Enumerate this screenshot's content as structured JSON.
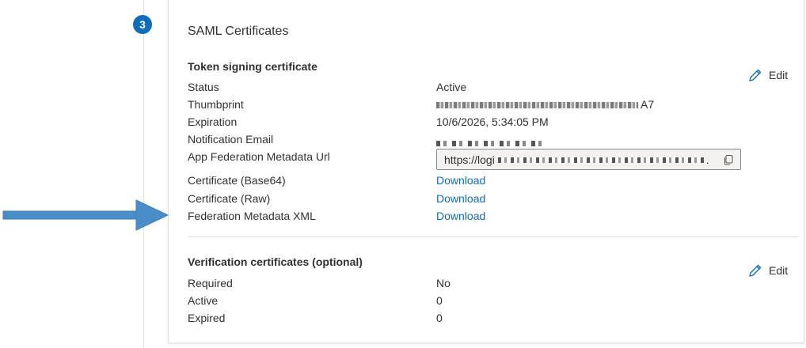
{
  "step": {
    "number": "3"
  },
  "card": {
    "title": "SAML Certificates"
  },
  "token_signing": {
    "title": "Token signing certificate",
    "edit_label": "Edit",
    "rows": [
      {
        "label": "Status",
        "value": "Active"
      },
      {
        "label": "Thumbprint",
        "value_suffix": "A7"
      },
      {
        "label": "Expiration",
        "value": "10/6/2026, 5:34:05 PM"
      },
      {
        "label": "Notification Email"
      },
      {
        "label": "App Federation Metadata Url",
        "url_prefix": "https://logi",
        "url_suffix": "."
      }
    ],
    "downloads": [
      {
        "label": "Certificate (Base64)",
        "link": "Download"
      },
      {
        "label": "Certificate (Raw)",
        "link": "Download"
      },
      {
        "label": "Federation Metadata XML",
        "link": "Download"
      }
    ]
  },
  "verification": {
    "title": "Verification certificates (optional)",
    "edit_label": "Edit",
    "rows": [
      {
        "label": "Required",
        "value": "No"
      },
      {
        "label": "Active",
        "value": "0"
      },
      {
        "label": "Expired",
        "value": "0"
      }
    ]
  },
  "colors": {
    "accent": "#0f6cbd",
    "arrow": "#4a8ec9",
    "text": "#323130",
    "border": "#e1dfdd"
  },
  "icons": {
    "edit": "pencil-icon",
    "copy": "copy-icon",
    "step": "step-badge"
  }
}
